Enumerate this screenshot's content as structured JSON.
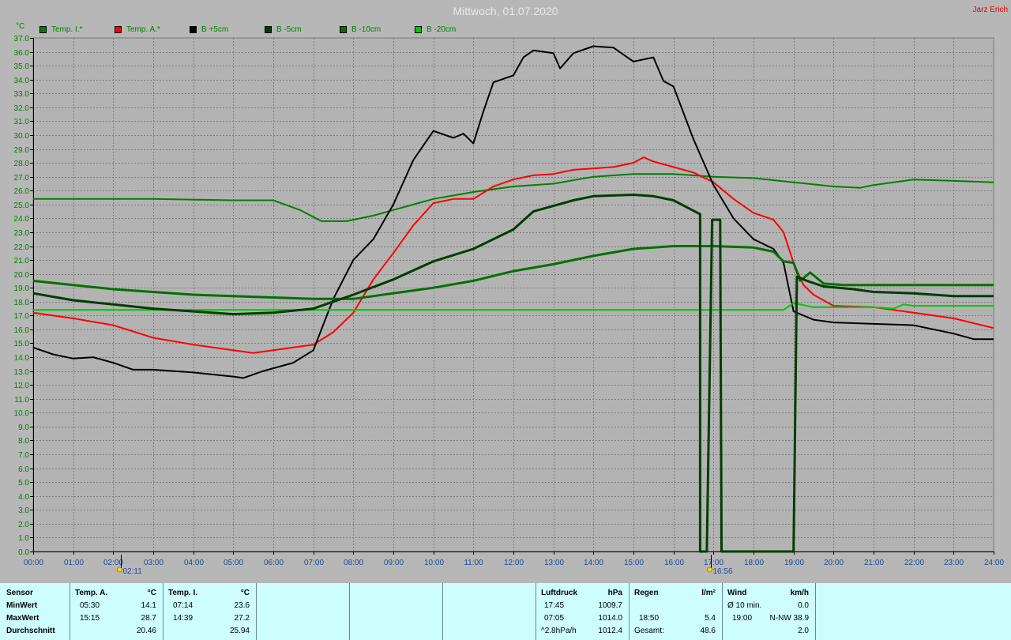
{
  "header": {
    "title": "Mittwoch, 01.07.2020",
    "author": "Jarz Erich",
    "unit": "°C"
  },
  "legend": [
    {
      "label": "Temp. I.*",
      "color": "#008000"
    },
    {
      "label": "Temp. A.*",
      "color": "#ff0000"
    },
    {
      "label": "B +5cm",
      "color": "#000000"
    },
    {
      "label": "B -5cm",
      "color": "#003c00"
    },
    {
      "label": "B -10cm",
      "color": "#007000"
    },
    {
      "label": "B -20cm",
      "color": "#00c800"
    }
  ],
  "markers": [
    {
      "time": 2.183,
      "label": "02:11"
    },
    {
      "time": 16.933,
      "label": "16:56"
    }
  ],
  "chart_data": {
    "type": "line",
    "title": "Mittwoch, 01.07.2020",
    "ylabel": "°C",
    "xlim": [
      "00:00",
      "24:00"
    ],
    "ylim": [
      0,
      37
    ],
    "y_tick_step": 0.1,
    "y_label_step": 1.0,
    "x_ticks": [
      "00:00",
      "01:00",
      "02:00",
      "03:00",
      "04:00",
      "05:00",
      "06:00",
      "07:00",
      "08:00",
      "09:00",
      "10:00",
      "11:00",
      "12:00",
      "13:00",
      "14:00",
      "15:00",
      "16:00",
      "17:00",
      "18:00",
      "19:00",
      "20:00",
      "21:00",
      "22:00",
      "23:00",
      "24:00"
    ],
    "grid": true,
    "series": [
      {
        "name": "Temp. I.*",
        "color": "#008000",
        "width": 2,
        "points": [
          [
            "00:00",
            25.4
          ],
          [
            "03:00",
            25.4
          ],
          [
            "05:00",
            25.3
          ],
          [
            "06:00",
            25.3
          ],
          [
            "06:40",
            24.6
          ],
          [
            "07:12",
            23.8
          ],
          [
            "07:50",
            23.8
          ],
          [
            "08:30",
            24.2
          ],
          [
            "09:00",
            24.6
          ],
          [
            "10:00",
            25.4
          ],
          [
            "11:00",
            25.9
          ],
          [
            "12:00",
            26.3
          ],
          [
            "13:00",
            26.5
          ],
          [
            "14:00",
            27.0
          ],
          [
            "15:00",
            27.2
          ],
          [
            "16:00",
            27.2
          ],
          [
            "17:00",
            27.0
          ],
          [
            "18:00",
            26.9
          ],
          [
            "19:00",
            26.6
          ],
          [
            "20:00",
            26.3
          ],
          [
            "20:40",
            26.2
          ],
          [
            "21:00",
            26.4
          ],
          [
            "22:00",
            26.8
          ],
          [
            "23:00",
            26.7
          ],
          [
            "24:00",
            26.6
          ]
        ]
      },
      {
        "name": "Temp. A.*",
        "color": "#ff0000",
        "width": 2,
        "points": [
          [
            "00:00",
            17.2
          ],
          [
            "00:30",
            17.0
          ],
          [
            "01:00",
            16.8
          ],
          [
            "02:00",
            16.3
          ],
          [
            "03:00",
            15.4
          ],
          [
            "04:00",
            14.9
          ],
          [
            "05:00",
            14.5
          ],
          [
            "05:30",
            14.3
          ],
          [
            "06:00",
            14.5
          ],
          [
            "07:00",
            14.9
          ],
          [
            "07:30",
            15.8
          ],
          [
            "08:00",
            17.2
          ],
          [
            "08:30",
            19.6
          ],
          [
            "09:00",
            21.5
          ],
          [
            "09:30",
            23.5
          ],
          [
            "10:00",
            25.1
          ],
          [
            "10:30",
            25.4
          ],
          [
            "11:00",
            25.4
          ],
          [
            "11:30",
            26.3
          ],
          [
            "12:00",
            26.8
          ],
          [
            "12:30",
            27.1
          ],
          [
            "13:00",
            27.2
          ],
          [
            "13:30",
            27.5
          ],
          [
            "14:00",
            27.6
          ],
          [
            "14:30",
            27.7
          ],
          [
            "15:00",
            28.0
          ],
          [
            "15:15",
            28.4
          ],
          [
            "15:30",
            28.1
          ],
          [
            "16:00",
            27.7
          ],
          [
            "16:30",
            27.3
          ],
          [
            "17:00",
            26.6
          ],
          [
            "17:30",
            25.4
          ],
          [
            "18:00",
            24.4
          ],
          [
            "18:30",
            23.9
          ],
          [
            "18:45",
            23.0
          ],
          [
            "19:00",
            20.8
          ],
          [
            "19:15",
            19.2
          ],
          [
            "19:30",
            18.5
          ],
          [
            "20:00",
            17.7
          ],
          [
            "21:00",
            17.6
          ],
          [
            "22:00",
            17.2
          ],
          [
            "23:00",
            16.8
          ],
          [
            "24:00",
            16.1
          ]
        ]
      },
      {
        "name": "B +5cm",
        "color": "#000000",
        "width": 2,
        "points": [
          [
            "00:00",
            14.7
          ],
          [
            "00:30",
            14.2
          ],
          [
            "01:00",
            13.9
          ],
          [
            "01:30",
            14.0
          ],
          [
            "02:00",
            13.6
          ],
          [
            "02:30",
            13.1
          ],
          [
            "03:00",
            13.1
          ],
          [
            "04:00",
            12.9
          ],
          [
            "05:00",
            12.6
          ],
          [
            "05:15",
            12.5
          ],
          [
            "05:45",
            13.0
          ],
          [
            "06:30",
            13.6
          ],
          [
            "07:00",
            14.5
          ],
          [
            "07:30",
            18.2
          ],
          [
            "08:00",
            21.0
          ],
          [
            "08:30",
            22.5
          ],
          [
            "09:00",
            25.0
          ],
          [
            "09:30",
            28.2
          ],
          [
            "10:00",
            30.3
          ],
          [
            "10:30",
            29.8
          ],
          [
            "10:45",
            30.1
          ],
          [
            "11:00",
            29.4
          ],
          [
            "11:15",
            31.7
          ],
          [
            "11:30",
            33.8
          ],
          [
            "12:00",
            34.3
          ],
          [
            "12:15",
            35.6
          ],
          [
            "12:30",
            36.1
          ],
          [
            "13:00",
            35.9
          ],
          [
            "13:10",
            34.8
          ],
          [
            "13:30",
            35.9
          ],
          [
            "14:00",
            36.4
          ],
          [
            "14:30",
            36.3
          ],
          [
            "15:00",
            35.3
          ],
          [
            "15:30",
            35.6
          ],
          [
            "15:45",
            33.9
          ],
          [
            "16:00",
            33.5
          ],
          [
            "16:30",
            29.7
          ],
          [
            "17:00",
            26.4
          ],
          [
            "17:30",
            24.0
          ],
          [
            "18:00",
            22.5
          ],
          [
            "18:30",
            21.8
          ],
          [
            "18:45",
            20.8
          ],
          [
            "19:00",
            17.3
          ],
          [
            "19:30",
            16.7
          ],
          [
            "20:00",
            16.5
          ],
          [
            "21:00",
            16.4
          ],
          [
            "22:00",
            16.3
          ],
          [
            "23:00",
            15.7
          ],
          [
            "23:30",
            15.3
          ],
          [
            "24:00",
            15.3
          ]
        ]
      },
      {
        "name": "B -5cm",
        "color": "#003c00",
        "width": 3,
        "points": [
          [
            "00:00",
            18.6
          ],
          [
            "01:00",
            18.1
          ],
          [
            "02:00",
            17.8
          ],
          [
            "03:00",
            17.5
          ],
          [
            "04:00",
            17.3
          ],
          [
            "05:00",
            17.1
          ],
          [
            "06:00",
            17.2
          ],
          [
            "07:00",
            17.5
          ],
          [
            "08:00",
            18.5
          ],
          [
            "09:00",
            19.6
          ],
          [
            "10:00",
            20.9
          ],
          [
            "11:00",
            21.8
          ],
          [
            "11:30",
            22.5
          ],
          [
            "12:00",
            23.2
          ],
          [
            "12:30",
            24.5
          ],
          [
            "13:00",
            24.9
          ],
          [
            "13:30",
            25.3
          ],
          [
            "14:00",
            25.6
          ],
          [
            "15:00",
            25.7
          ],
          [
            "15:30",
            25.6
          ],
          [
            "16:00",
            25.3
          ],
          [
            "16:40",
            24.3
          ],
          [
            "16:40",
            0.0
          ],
          [
            "16:50",
            0.0
          ],
          [
            "16:58",
            23.9
          ],
          [
            "17:10",
            23.9
          ],
          [
            "17:12",
            0.0
          ],
          [
            "19:00",
            0.0
          ],
          [
            "19:05",
            19.8
          ],
          [
            "19:20",
            19.5
          ],
          [
            "19:45",
            19.1
          ],
          [
            "20:30",
            18.9
          ],
          [
            "21:00",
            18.7
          ],
          [
            "22:00",
            18.6
          ],
          [
            "23:00",
            18.4
          ],
          [
            "24:00",
            18.4
          ]
        ]
      },
      {
        "name": "B -10cm",
        "color": "#007000",
        "width": 3,
        "points": [
          [
            "00:00",
            19.5
          ],
          [
            "01:00",
            19.2
          ],
          [
            "02:00",
            18.9
          ],
          [
            "03:00",
            18.7
          ],
          [
            "04:00",
            18.5
          ],
          [
            "05:00",
            18.4
          ],
          [
            "06:00",
            18.3
          ],
          [
            "07:00",
            18.2
          ],
          [
            "08:00",
            18.2
          ],
          [
            "09:00",
            18.6
          ],
          [
            "10:00",
            19.0
          ],
          [
            "11:00",
            19.5
          ],
          [
            "12:00",
            20.2
          ],
          [
            "13:00",
            20.7
          ],
          [
            "14:00",
            21.3
          ],
          [
            "15:00",
            21.8
          ],
          [
            "16:00",
            22.0
          ],
          [
            "17:00",
            22.0
          ],
          [
            "18:00",
            21.9
          ],
          [
            "18:30",
            21.6
          ],
          [
            "18:45",
            20.9
          ],
          [
            "19:00",
            20.8
          ],
          [
            "19:10",
            19.5
          ],
          [
            "19:25",
            20.1
          ],
          [
            "19:45",
            19.3
          ],
          [
            "20:15",
            19.2
          ],
          [
            "21:00",
            19.2
          ],
          [
            "22:00",
            19.2
          ],
          [
            "24:00",
            19.2
          ]
        ]
      },
      {
        "name": "B -20cm",
        "color": "#00c800",
        "width": 2,
        "points": [
          [
            "00:00",
            17.4
          ],
          [
            "06:00",
            17.4
          ],
          [
            "12:00",
            17.4
          ],
          [
            "18:00",
            17.4
          ],
          [
            "18:45",
            17.4
          ],
          [
            "19:00",
            17.9
          ],
          [
            "19:30",
            17.6
          ],
          [
            "20:00",
            17.6
          ],
          [
            "21:00",
            17.6
          ],
          [
            "21:30",
            17.5
          ],
          [
            "21:45",
            17.8
          ],
          [
            "22:00",
            17.7
          ],
          [
            "24:00",
            17.7
          ]
        ]
      }
    ]
  },
  "stats": {
    "sensor": {
      "title": "Sensor",
      "min": "MinWert",
      "max": "MaxWert",
      "avg": "Durchschnitt"
    },
    "temp_a": {
      "title": "Temp. A.",
      "unit": "°C",
      "min_time": "05:30",
      "min_val": "14.1",
      "max_time": "15:15",
      "max_val": "28.7",
      "avg": "20.46"
    },
    "temp_i": {
      "title": "Temp. I.",
      "unit": "°C",
      "min_time": "07:14",
      "min_val": "23.6",
      "max_time": "14:39",
      "max_val": "27.2",
      "avg": "25.94"
    },
    "pressure": {
      "title": "Luftdruck",
      "unit": "hPa",
      "min_time": "17:45",
      "min_val": "1009.7",
      "max_time": "07:05",
      "max_val": "1014.0",
      "trend": "^2.8hPa/h",
      "trend_val": "1012.4"
    },
    "rain": {
      "title": "Regen",
      "unit": "l/m²",
      "time": "18:50",
      "val": "5.4",
      "total_label": "Gesamt:",
      "total": "48.6"
    },
    "wind": {
      "title": "Wind",
      "unit": "km/h",
      "avg_label": "Ø 10 min.",
      "avg_val": "0.0",
      "gust_time": "19:00",
      "gust_val": "N-NW 38.9",
      "third_val": "2.0"
    }
  }
}
